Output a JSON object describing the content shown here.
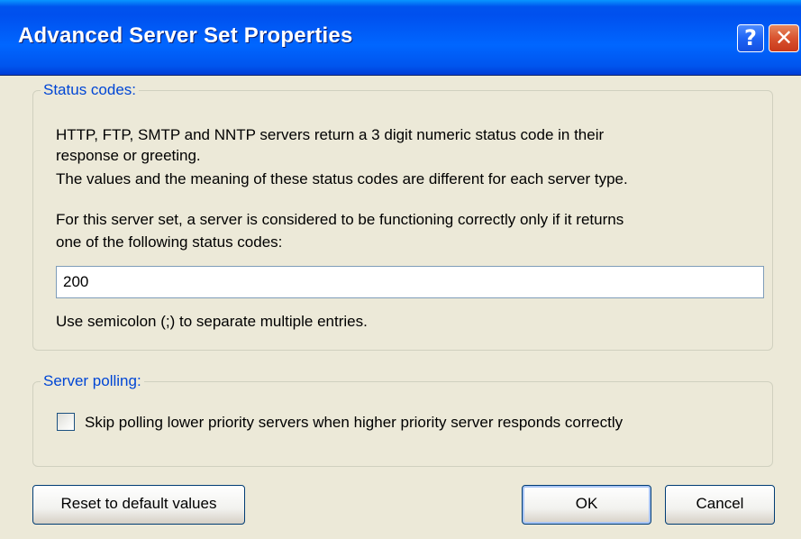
{
  "window": {
    "title": "Advanced Server Set Properties",
    "help_glyph": "?",
    "close_glyph": "✕"
  },
  "status_codes": {
    "legend": "Status codes:",
    "description_line1": "HTTP, FTP, SMTP and NNTP servers return a 3 digit numeric status code in their",
    "description_line2": "response or greeting.",
    "description_line3": "The values and the meaning of these status codes are different for each server type.",
    "instruction_line1": "For this server set, a server is considered to be functioning correctly only if it returns",
    "instruction_line2": "one of the following status codes:",
    "input_value": "200",
    "hint": "Use semicolon (;) to separate multiple entries."
  },
  "server_polling": {
    "legend": "Server polling:",
    "skip_label": "Skip polling lower priority servers when higher priority server responds correctly",
    "skip_checked": false
  },
  "buttons": {
    "reset_label": "Reset to default values",
    "ok_label": "OK",
    "cancel_label": "Cancel"
  },
  "colors": {
    "titlebar": "#0055ee",
    "dialog_background": "#ece9d8",
    "legend_text": "#0046d5",
    "close_button": "#d9532f"
  },
  "icons": {
    "help": "help-icon",
    "close": "close-icon"
  }
}
